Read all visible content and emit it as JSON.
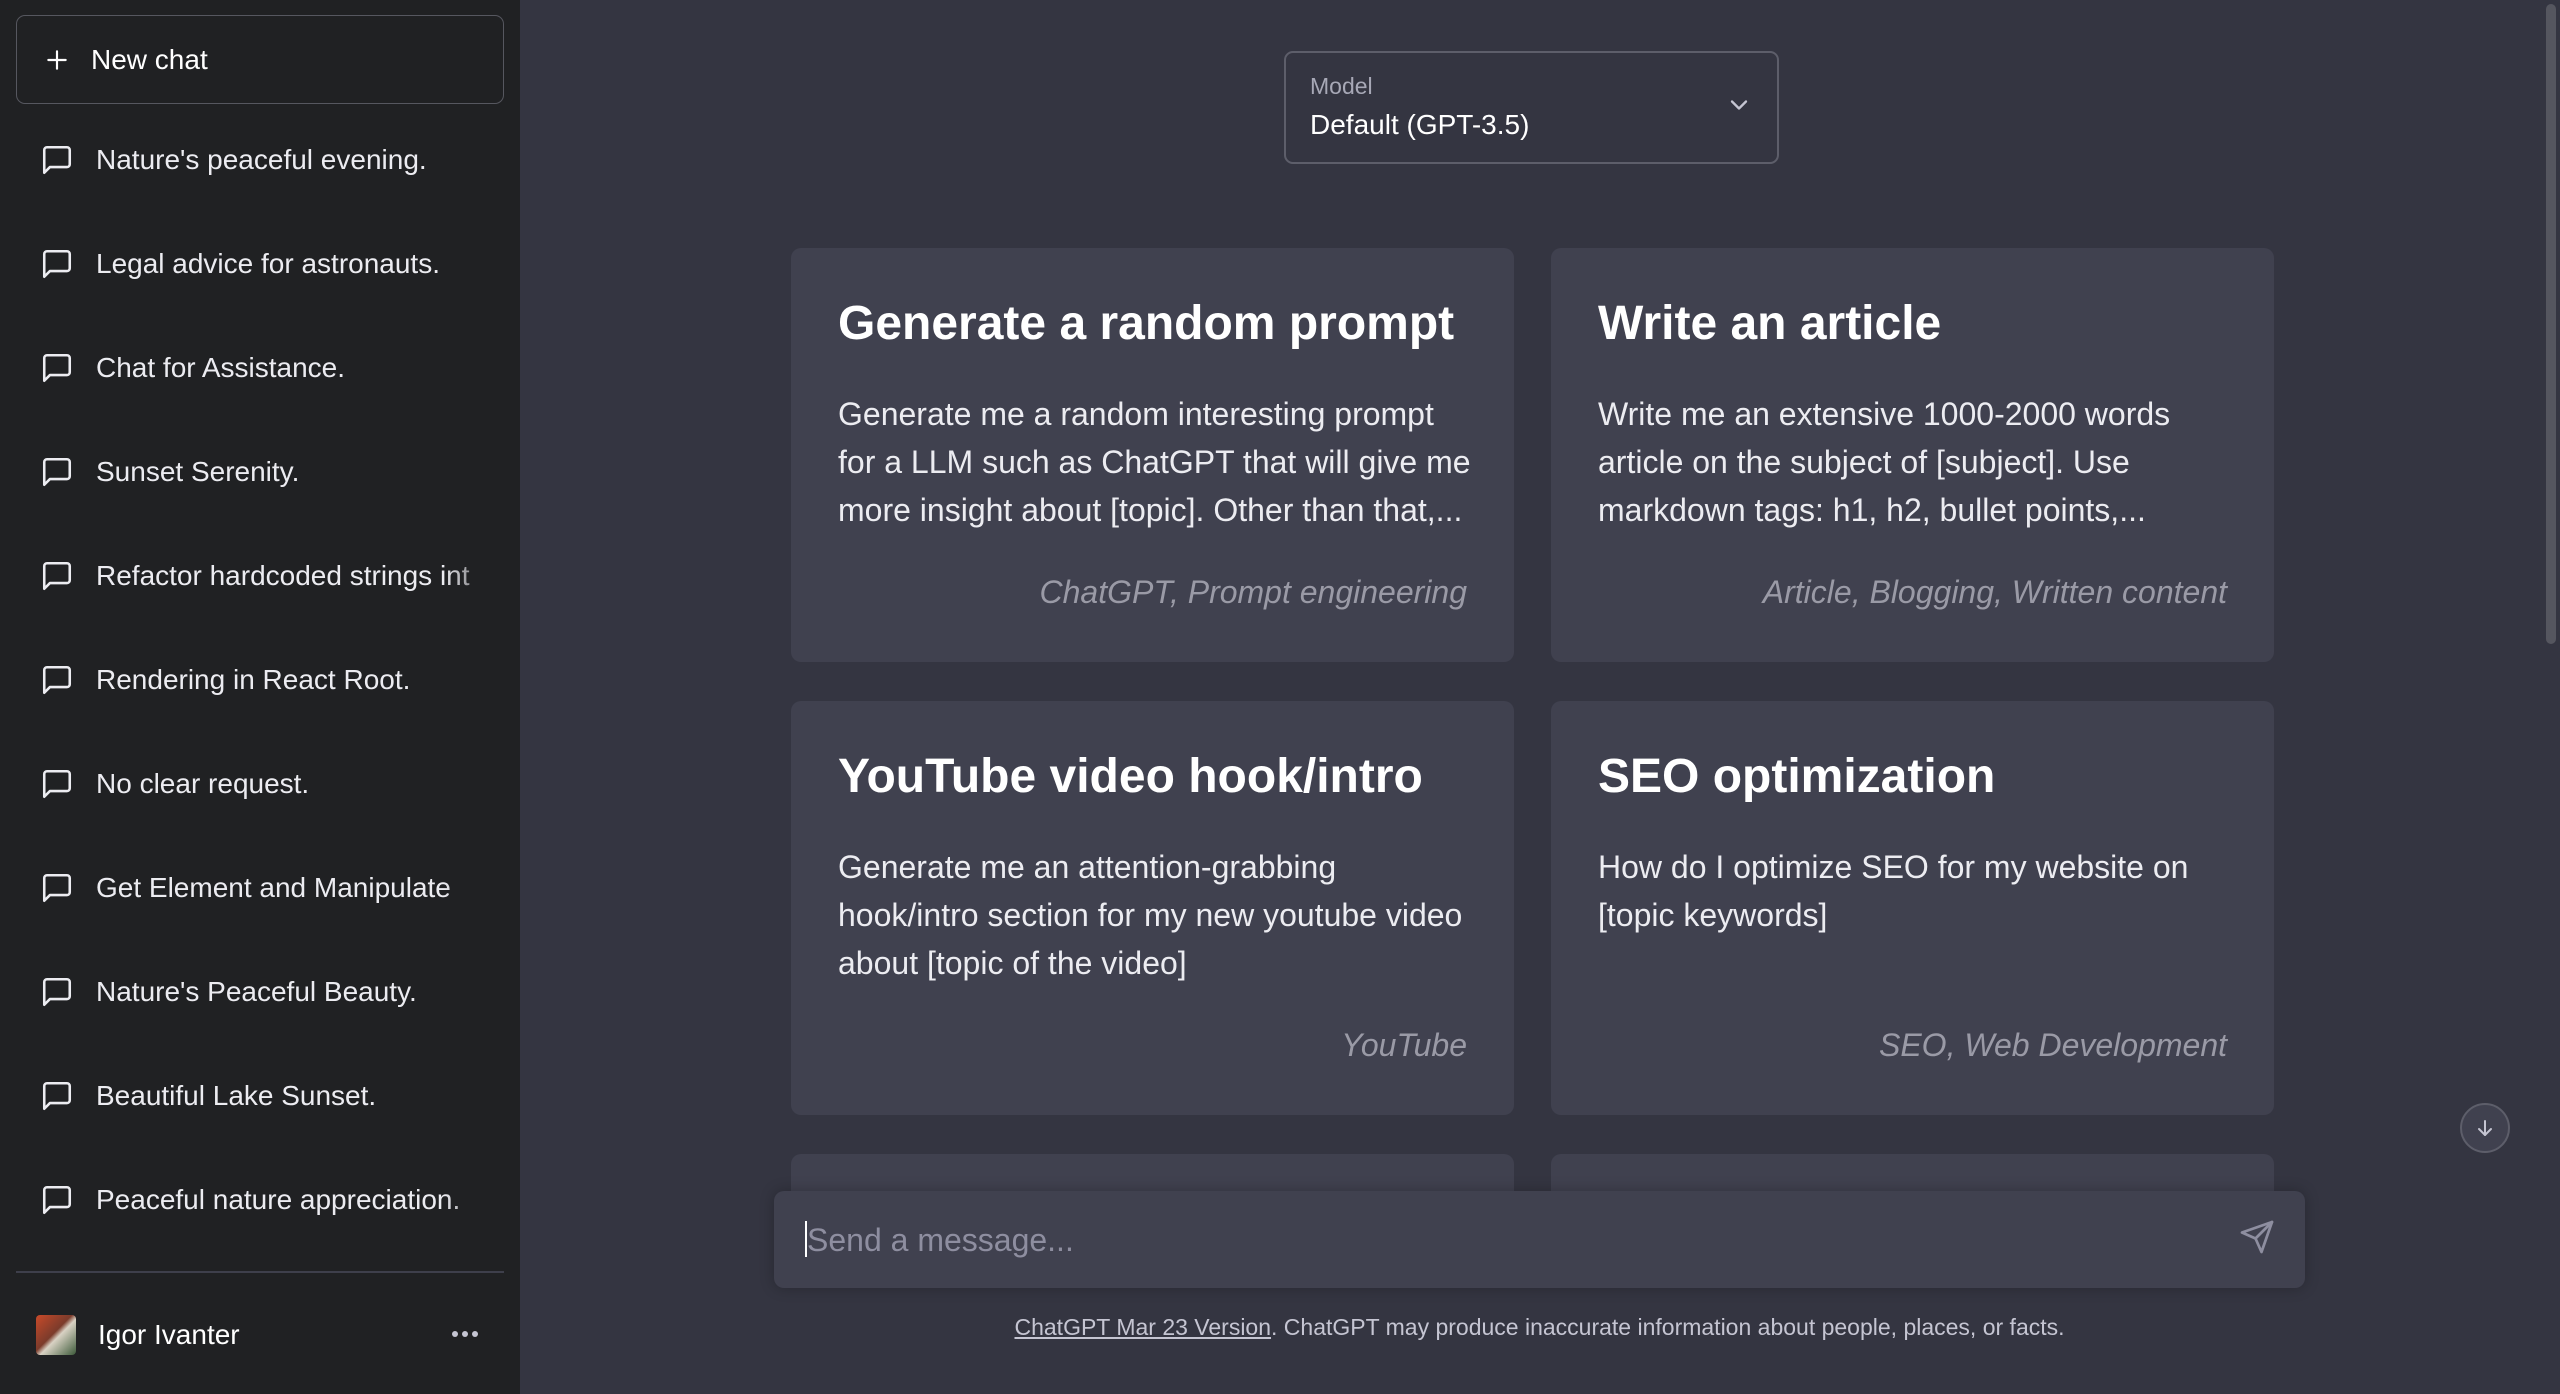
{
  "sidebar": {
    "new_chat_label": "New chat",
    "history": [
      "Nature's peaceful evening.",
      "Legal advice for astronauts.",
      "Chat for Assistance.",
      "Sunset Serenity.",
      "Refactor hardcoded strings int",
      "Rendering in React Root.",
      "No clear request.",
      "Get Element and Manipulate",
      "Nature's Peaceful Beauty.",
      "Beautiful Lake Sunset.",
      "Peaceful nature appreciation."
    ],
    "user_name": "Igor Ivanter"
  },
  "model_selector": {
    "caption": "Model",
    "value": "Default (GPT-3.5)"
  },
  "prompt_cards": [
    {
      "title": "Generate a random prompt",
      "description": "Generate me a random interesting prompt for a LLM such as ChatGPT that will give me more insight about [topic]. Other than that,...",
      "tags": "ChatGPT, Prompt engineering"
    },
    {
      "title": "Write an article",
      "description": "Write me an extensive 1000-2000 words article on the subject of [subject]. Use markdown tags: h1, h2, bullet points,...",
      "tags": "Article, Blogging, Written content"
    },
    {
      "title": "YouTube video hook/intro",
      "description": "Generate me an attention-grabbing hook/intro section for my new youtube video about [topic of the video]",
      "tags": "YouTube"
    },
    {
      "title": "SEO optimization",
      "description": "How do I optimize SEO for my website on [topic keywords]",
      "tags": "SEO, Web Development"
    }
  ],
  "composer": {
    "placeholder": "Send a message..."
  },
  "footer": {
    "link_text": "ChatGPT Mar 23 Version",
    "text": ". ChatGPT may produce inaccurate information about people, places, or facts."
  },
  "icons": {
    "new_chat": "plus-icon",
    "history": "message-square-icon",
    "model": "chevron-down-icon",
    "send": "send-icon",
    "more": "more-horizontal-icon",
    "scroll": "arrow-down-icon"
  },
  "colors": {
    "sidebar_bg": "#202123",
    "main_bg": "#343541",
    "card_bg": "#40414f"
  }
}
